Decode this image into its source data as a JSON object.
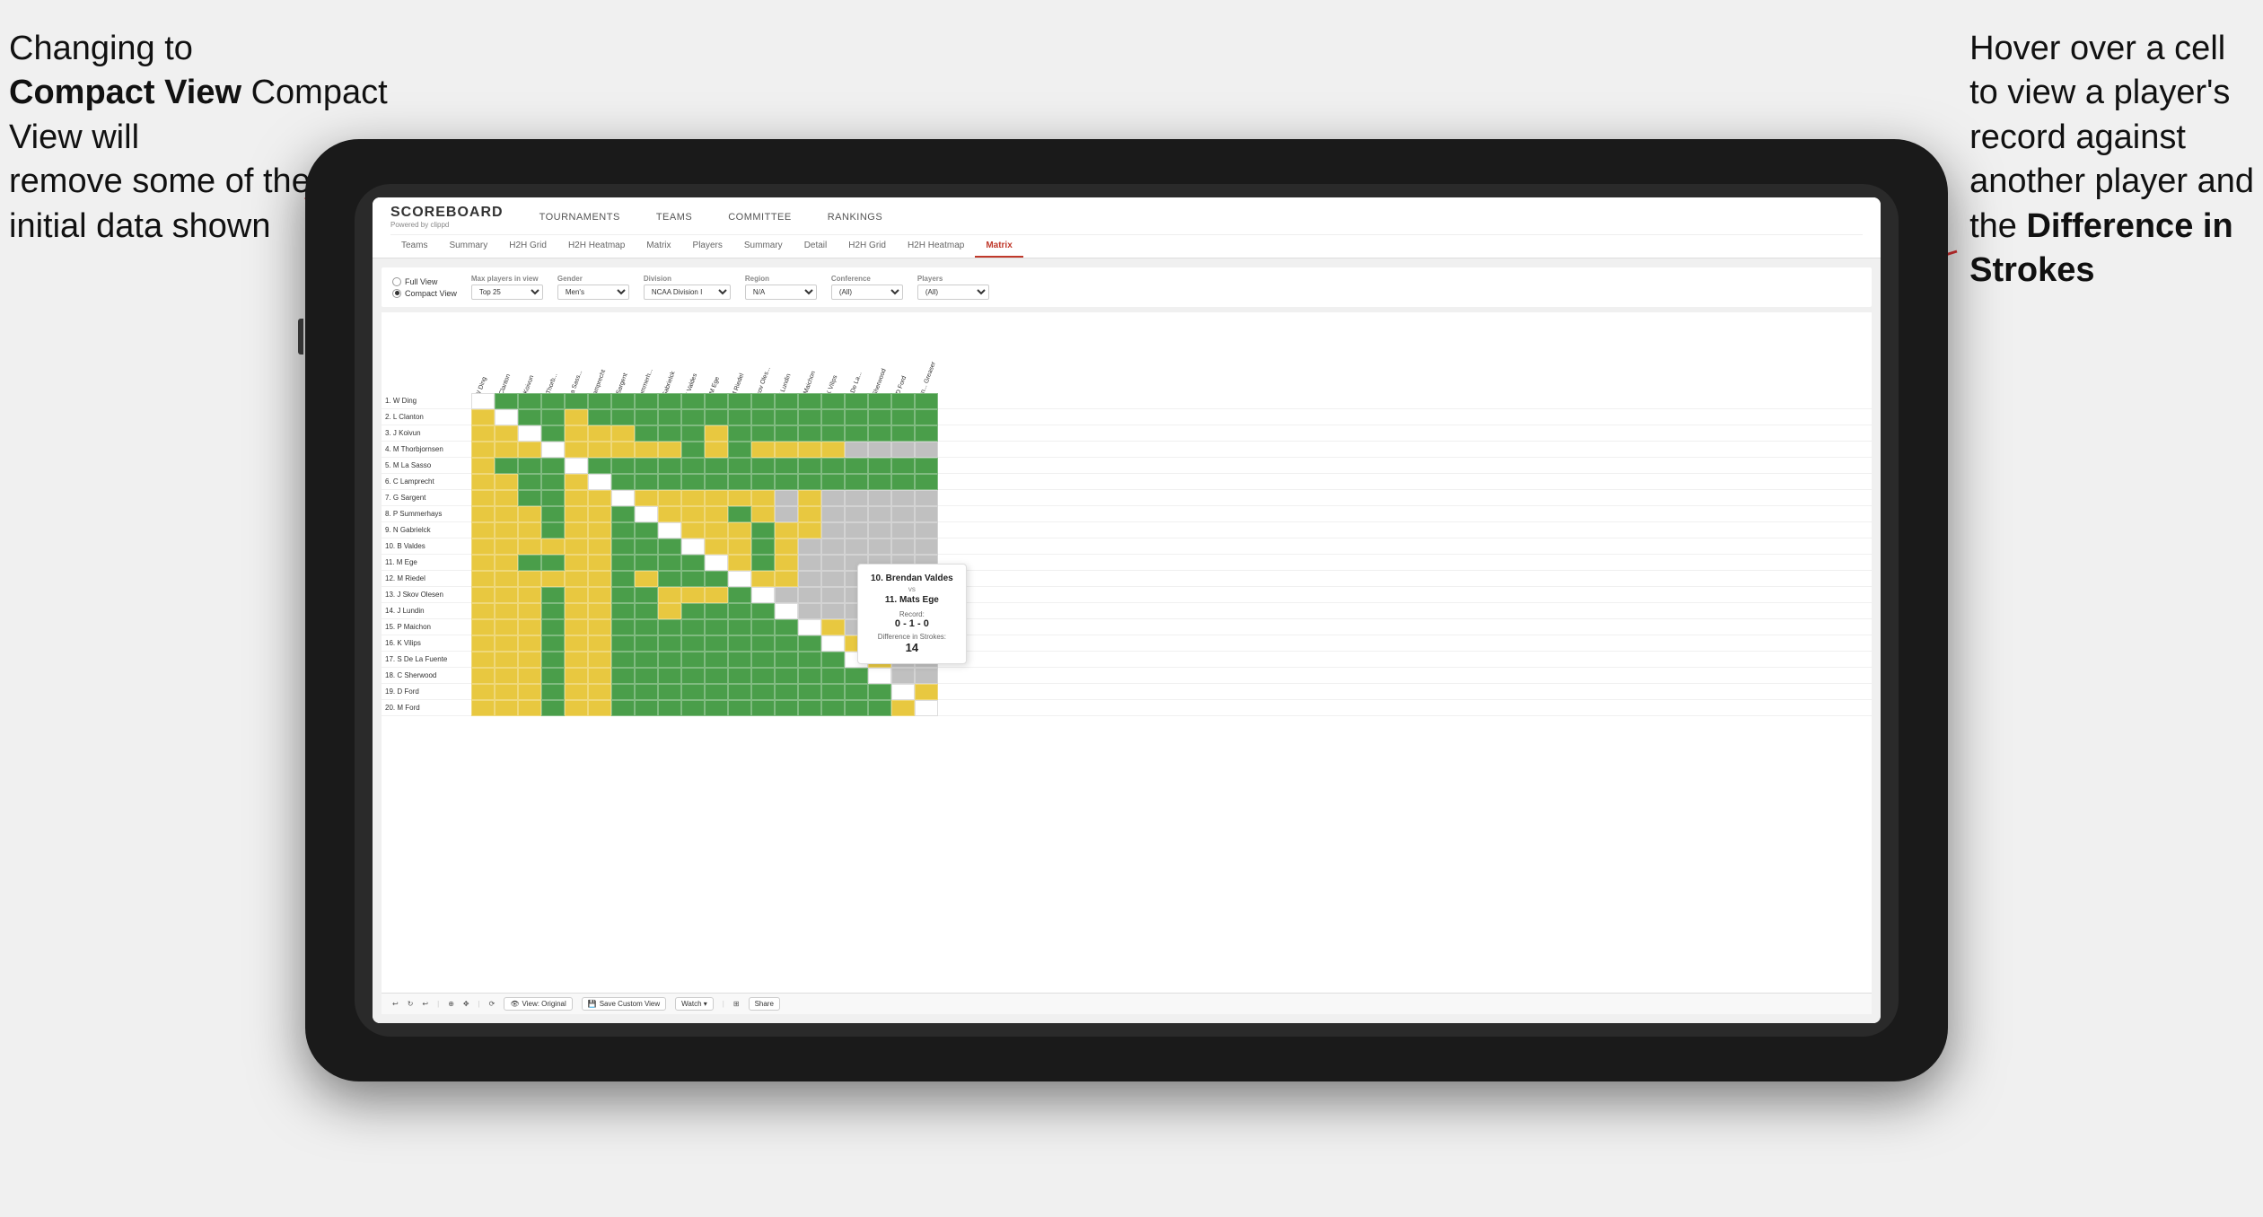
{
  "annotations": {
    "left": {
      "line1": "Changing to",
      "line2": "Compact View will",
      "line3": "remove some of the",
      "line4": "initial data shown"
    },
    "right": {
      "line1": "Hover over a cell",
      "line2": "to view a player's",
      "line3": "record against",
      "line4": "another player and",
      "line5": "the",
      "line6": "Difference in",
      "line7": "Strokes"
    }
  },
  "nav": {
    "logo": "SCOREBOARD",
    "logo_sub": "Powered by clippd",
    "menu_items": [
      "TOURNAMENTS",
      "TEAMS",
      "COMMITTEE",
      "RANKINGS"
    ],
    "tabs_top": [
      "Teams",
      "Summary",
      "H2H Grid",
      "H2H Heatmap",
      "Matrix",
      "Players",
      "Summary",
      "Detail",
      "H2H Grid",
      "H2H Heatmap",
      "Matrix"
    ],
    "active_tab": "Matrix"
  },
  "filters": {
    "view_options": [
      "Full View",
      "Compact View"
    ],
    "selected_view": "Compact View",
    "max_players_label": "Max players in view",
    "max_players_value": "Top 25",
    "gender_label": "Gender",
    "gender_value": "Men's",
    "division_label": "Division",
    "division_value": "NCAA Division I",
    "region_label": "Region",
    "region_value": "N/A",
    "conference_label": "Conference",
    "conference_value": "(All)",
    "players_label": "Players",
    "players_value": "(All)"
  },
  "players": [
    "1. W Ding",
    "2. L Clanton",
    "3. J Koivun",
    "4. M Thorbjornsen",
    "5. M La Sasso",
    "6. C Lamprecht",
    "7. G Sargent",
    "8. P Summerhays",
    "9. N Gabrielck",
    "10. B Valdes",
    "11. M Ege",
    "12. M Riedel",
    "13. J Skov Olesen",
    "14. J Lundin",
    "15. P Maichon",
    "16. K Vilips",
    "17. S De La Fuente",
    "18. C Sherwood",
    "19. D Ford",
    "20. M Ford"
  ],
  "col_headers": [
    "1. W Ding",
    "2. L Clanton",
    "3. J Koivun",
    "4. M Thorb...",
    "5. M La Sass...",
    "6. C Lamprecht",
    "7. G Sargent",
    "8. P Summerh...",
    "9. N Gabrielck",
    "10. B Valdes",
    "11. M Ege",
    "12. M Riedel",
    "13. J Skov Oles...",
    "14. J Lundin",
    "15. P Maichon",
    "16. K Vilips",
    "17. S De La...",
    "18. C Sherwood",
    "19. D Ford",
    "20. M Fern... Greaser"
  ],
  "tooltip": {
    "player1": "10. Brendan Valdes",
    "vs": "vs",
    "player2": "11. Mats Ege",
    "record_label": "Record:",
    "record": "0 - 1 - 0",
    "diff_label": "Difference in Strokes:",
    "diff": "14"
  },
  "toolbar": {
    "undo": "↩",
    "redo": "↪",
    "view_original": "View: Original",
    "save_custom": "Save Custom View",
    "watch": "Watch ▾",
    "share": "Share"
  }
}
